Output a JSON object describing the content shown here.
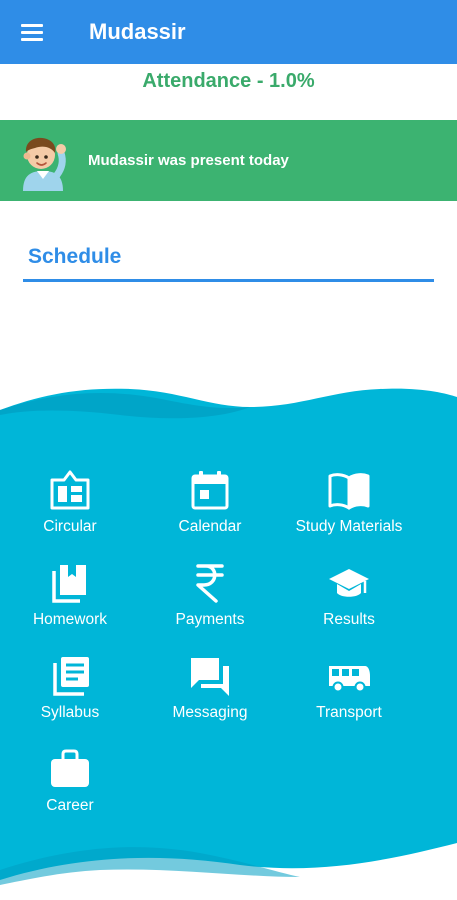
{
  "app": {
    "title": "Mudassir"
  },
  "attendance": {
    "text": "Attendance - 1.0%"
  },
  "banner": {
    "message": "Mudassir was present today"
  },
  "schedule": {
    "label": "Schedule"
  },
  "colors": {
    "appbar": "#2f8de7",
    "attendance_text": "#3aaa6b",
    "banner": "#3cb371",
    "panel": "#00b6d8"
  },
  "menu": [
    {
      "label": "Circular",
      "icon": "circular-icon"
    },
    {
      "label": "Calendar",
      "icon": "calendar-icon"
    },
    {
      "label": "Study Materials",
      "icon": "book-icon"
    },
    {
      "label": "Homework",
      "icon": "homework-icon"
    },
    {
      "label": "Payments",
      "icon": "rupee-icon"
    },
    {
      "label": "Results",
      "icon": "graduation-cap-icon"
    },
    {
      "label": "Syllabus",
      "icon": "syllabus-icon"
    },
    {
      "label": "Messaging",
      "icon": "chat-icon"
    },
    {
      "label": "Transport",
      "icon": "bus-icon"
    },
    {
      "label": "Career",
      "icon": "briefcase-icon"
    }
  ]
}
